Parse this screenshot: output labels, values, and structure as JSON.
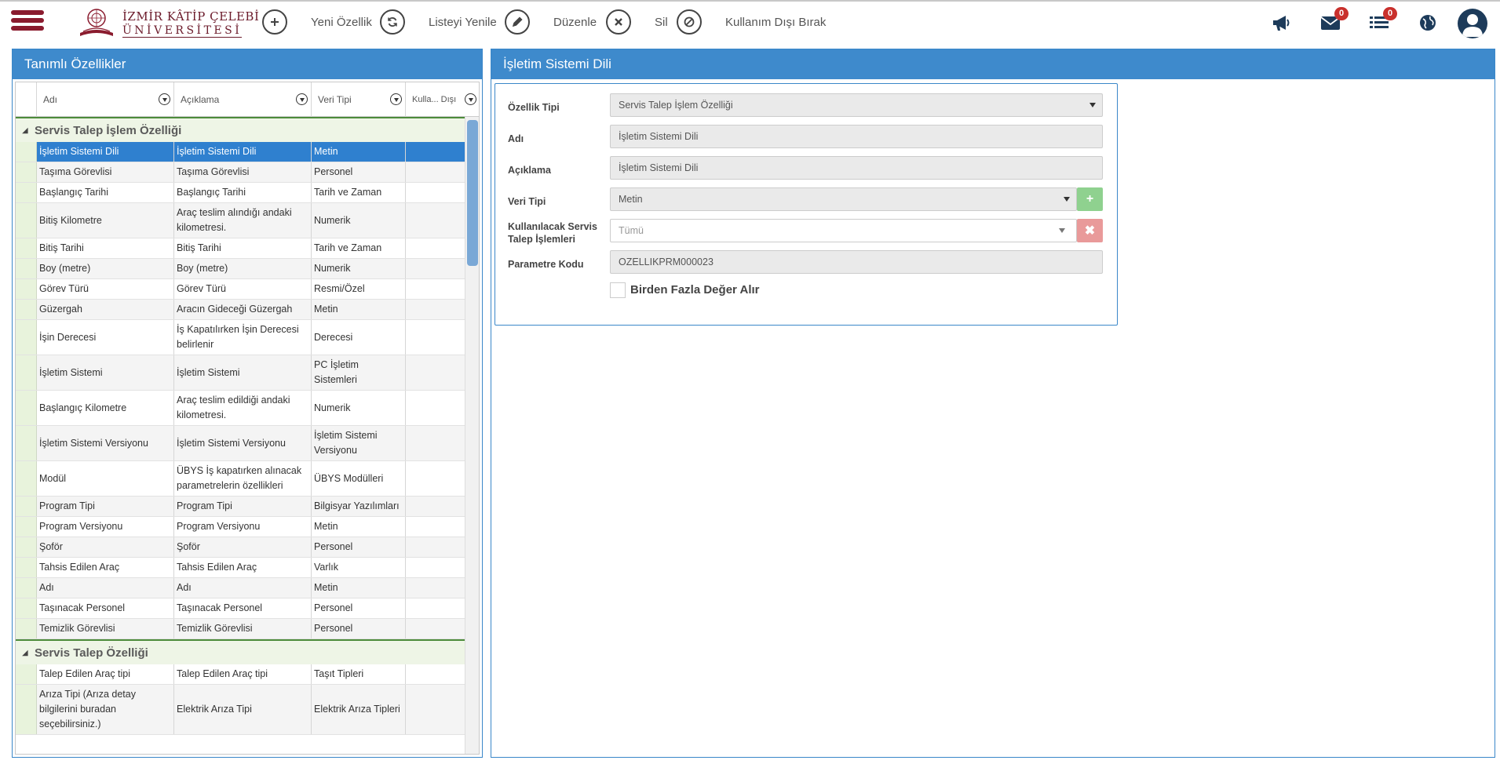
{
  "header": {
    "logo": {
      "line1": "İZMİR KÂTİP ÇELEBİ",
      "line2": "ÜNİVERSİTESİ"
    },
    "toolbar": [
      {
        "label": "Yeni Özellik",
        "icon": "plus-icon"
      },
      {
        "label": "Listeyi Yenile",
        "icon": "refresh-icon"
      },
      {
        "label": "Düzenle",
        "icon": "pencil-icon"
      },
      {
        "label": "Sil",
        "icon": "close-icon"
      },
      {
        "label": "Kullanım Dışı Bırak",
        "icon": "ban-icon"
      }
    ],
    "right_icons": [
      {
        "icon": "megaphone-icon"
      },
      {
        "icon": "envelope-icon",
        "badge": "0"
      },
      {
        "icon": "list-icon",
        "badge": "0"
      },
      {
        "icon": "globe-icon"
      },
      {
        "icon": "user-avatar-icon"
      }
    ],
    "accent_color": "#8a1b2e"
  },
  "left_panel": {
    "title": "Tanımlı Özellikler",
    "columns": [
      "Adı",
      "Açıklama",
      "Veri Tipi",
      "Kulla... Dışı"
    ],
    "groups": [
      {
        "name": "Servis Talep İşlem Özelliği",
        "rows": [
          {
            "ad": "İşletim Sistemi Dili",
            "aciklama": "İşletim Sistemi Dili",
            "veri_tipi": "Metin",
            "kullanim_disi": "",
            "selected": true
          },
          {
            "ad": "Taşıma Görevlisi",
            "aciklama": "Taşıma Görevlisi",
            "veri_tipi": "Personel",
            "kullanim_disi": ""
          },
          {
            "ad": "Başlangıç Tarihi",
            "aciklama": "Başlangıç Tarihi",
            "veri_tipi": "Tarih ve Zaman",
            "kullanim_disi": ""
          },
          {
            "ad": "Bitiş Kilometre",
            "aciklama": "Araç teslim alındığı andaki kilometresi.",
            "veri_tipi": "Numerik",
            "kullanim_disi": ""
          },
          {
            "ad": "Bitiş Tarihi",
            "aciklama": "Bitiş Tarihi",
            "veri_tipi": "Tarih ve Zaman",
            "kullanim_disi": ""
          },
          {
            "ad": "Boy (metre)",
            "aciklama": "Boy (metre)",
            "veri_tipi": "Numerik",
            "kullanim_disi": ""
          },
          {
            "ad": "Görev Türü",
            "aciklama": "Görev Türü",
            "veri_tipi": "Resmi/Özel",
            "kullanim_disi": ""
          },
          {
            "ad": "Güzergah",
            "aciklama": "Aracın Gideceği Güzergah",
            "veri_tipi": "Metin",
            "kullanim_disi": ""
          },
          {
            "ad": "İşin Derecesi",
            "aciklama": "İş Kapatılırken İşin Derecesi belirlenir",
            "veri_tipi": "Derecesi",
            "kullanim_disi": ""
          },
          {
            "ad": "İşletim Sistemi",
            "aciklama": "İşletim Sistemi",
            "veri_tipi": "PC İşletim Sistemleri",
            "kullanim_disi": ""
          },
          {
            "ad": "Başlangıç Kilometre",
            "aciklama": "Araç teslim edildiği andaki kilometresi.",
            "veri_tipi": "Numerik",
            "kullanim_disi": ""
          },
          {
            "ad": "İşletim Sistemi Versiyonu",
            "aciklama": "İşletim Sistemi Versiyonu",
            "veri_tipi": "İşletim Sistemi Versiyonu",
            "kullanim_disi": ""
          },
          {
            "ad": "Modül",
            "aciklama": "ÜBYS İş kapatırken alınacak parametrelerin özellikleri",
            "veri_tipi": "ÜBYS Modülleri",
            "kullanim_disi": ""
          },
          {
            "ad": "Program Tipi",
            "aciklama": "Program Tipi",
            "veri_tipi": "Bilgisyar Yazılımları",
            "kullanim_disi": ""
          },
          {
            "ad": "Program Versiyonu",
            "aciklama": "Program Versiyonu",
            "veri_tipi": "Metin",
            "kullanim_disi": ""
          },
          {
            "ad": "Şoför",
            "aciklama": "Şoför",
            "veri_tipi": "Personel",
            "kullanim_disi": ""
          },
          {
            "ad": "Tahsis Edilen Araç",
            "aciklama": "Tahsis Edilen Araç",
            "veri_tipi": "Varlık",
            "kullanim_disi": ""
          },
          {
            "ad": "Adı",
            "aciklama": "Adı",
            "veri_tipi": "Metin",
            "kullanim_disi": ""
          },
          {
            "ad": "Taşınacak Personel",
            "aciklama": "Taşınacak Personel",
            "veri_tipi": "Personel",
            "kullanim_disi": ""
          },
          {
            "ad": "Temizlik Görevlisi",
            "aciklama": "Temizlik Görevlisi",
            "veri_tipi": "Personel",
            "kullanim_disi": ""
          }
        ]
      },
      {
        "name": "Servis Talep Özelliği",
        "rows": [
          {
            "ad": "Talep Edilen Araç tipi",
            "aciklama": "Talep Edilen Araç tipi",
            "veri_tipi": "Taşıt Tipleri",
            "kullanim_disi": ""
          },
          {
            "ad": "Arıza Tipi (Arıza detay bilgilerini buradan seçebilirsiniz.)",
            "aciklama": "Elektrik Arıza Tipi",
            "veri_tipi": "Elektrik Arıza Tipleri",
            "kullanim_disi": ""
          }
        ]
      }
    ]
  },
  "right_panel": {
    "title": "İşletim Sistemi Dili",
    "form": {
      "ozellik_tipi": {
        "label": "Özellik Tipi",
        "value": "Servis Talep İşlem Özelliği"
      },
      "adi": {
        "label": "Adı",
        "value": "İşletim Sistemi Dili"
      },
      "aciklama": {
        "label": "Açıklama",
        "value": "İşletim Sistemi Dili"
      },
      "veri_tipi": {
        "label": "Veri Tipi",
        "value": "Metin"
      },
      "kullanilacak": {
        "label": "Kullanılacak Servis Talep İşlemleri",
        "placeholder": "Tümü"
      },
      "parametre_kodu": {
        "label": "Parametre Kodu",
        "value": "OZELLIKPRM000023"
      },
      "birden_fazla": {
        "label": "Birden Fazla Değer Alır",
        "checked": false
      }
    },
    "colors": {
      "add_button": "#8fd18f",
      "remove_button": "#e99a9a",
      "panel_header": "#3e8acc"
    }
  }
}
